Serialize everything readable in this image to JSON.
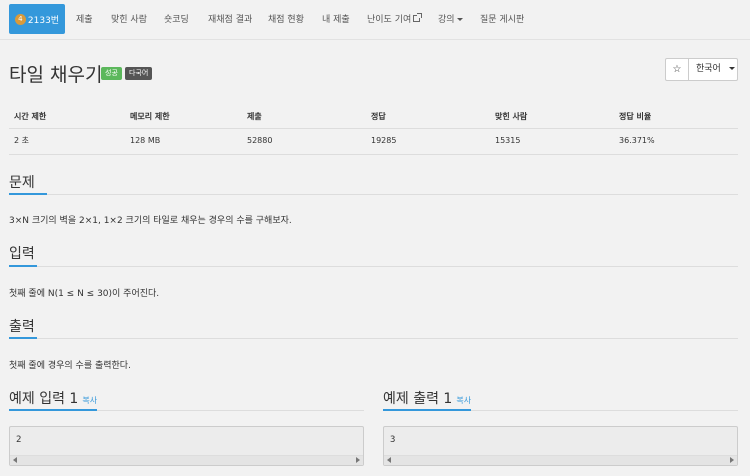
{
  "nav": {
    "problem_id": "2133번",
    "level_mark": "4",
    "items": [
      "제출",
      "맞힌 사람",
      "숏코딩",
      "재채점 결과",
      "채점 현황",
      "내 제출",
      "난이도 기여",
      "강의",
      "질문 게시판"
    ]
  },
  "problem": {
    "title": "타일 채우기",
    "badge_success": "성공",
    "badge_lang": "다국어",
    "star": "☆",
    "language_select": "한국어"
  },
  "stats": {
    "headers": [
      "시간 제한",
      "메모리 제한",
      "제출",
      "정답",
      "맞힌 사람",
      "정답 비율"
    ],
    "values": [
      "2 초",
      "128 MB",
      "52880",
      "19285",
      "15315",
      "36.371%"
    ]
  },
  "sections": {
    "problem": {
      "title": "문제",
      "text": "3×N 크기의 벽을 2×1, 1×2 크기의 타일로 채우는 경우의 수를 구해보자."
    },
    "input": {
      "title": "입력",
      "text": "첫째 줄에 N(1 ≤ N ≤ 30)이 주어진다."
    },
    "output": {
      "title": "출력",
      "text": "첫째 줄에 경우의 수를 출력한다."
    }
  },
  "samples": {
    "input_title": "예제 입력 1",
    "output_title": "예제 출력 1",
    "copy_label": "복사",
    "input_value": "2",
    "output_value": "3"
  }
}
